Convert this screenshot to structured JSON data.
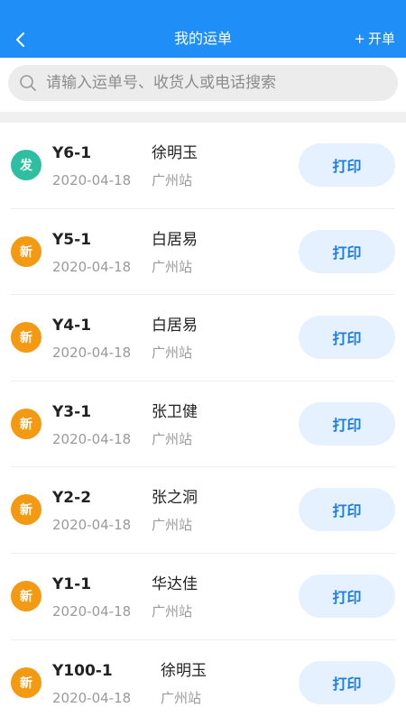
{
  "nav": {
    "title": "我的运单",
    "new_order_label": "开单",
    "new_order_plus": "+"
  },
  "search": {
    "placeholder": "请输入运单号、收货人或电话搜索",
    "value": ""
  },
  "colors": {
    "primary": "#1f8ef7",
    "badge_sent": "#2ebfa0",
    "badge_new": "#f39a12",
    "print_button_bg": "#e5f1fe",
    "print_button_text": "#1f7fe0"
  },
  "orders": [
    {
      "badge": "发",
      "status": "sent",
      "waybill": "Y6-1",
      "date": "2020-04-18",
      "receiver": "徐明玉",
      "station": "广州站",
      "print_label": "打印"
    },
    {
      "badge": "新",
      "status": "new",
      "waybill": "Y5-1",
      "date": "2020-04-18",
      "receiver": "白居易",
      "station": "广州站",
      "print_label": "打印"
    },
    {
      "badge": "新",
      "status": "new",
      "waybill": "Y4-1",
      "date": "2020-04-18",
      "receiver": "白居易",
      "station": "广州站",
      "print_label": "打印"
    },
    {
      "badge": "新",
      "status": "new",
      "waybill": "Y3-1",
      "date": "2020-04-18",
      "receiver": "张卫健",
      "station": "广州站",
      "print_label": "打印"
    },
    {
      "badge": "新",
      "status": "new",
      "waybill": "Y2-2",
      "date": "2020-04-18",
      "receiver": "张之洞",
      "station": "广州站",
      "print_label": "打印"
    },
    {
      "badge": "新",
      "status": "new",
      "waybill": "Y1-1",
      "date": "2020-04-18",
      "receiver": "华达佳",
      "station": "广州站",
      "print_label": "打印"
    },
    {
      "badge": "新",
      "status": "new",
      "waybill": "Y100-1",
      "date": "2020-04-18",
      "receiver": "徐明玉",
      "station": "广州站",
      "print_label": "打印"
    }
  ]
}
